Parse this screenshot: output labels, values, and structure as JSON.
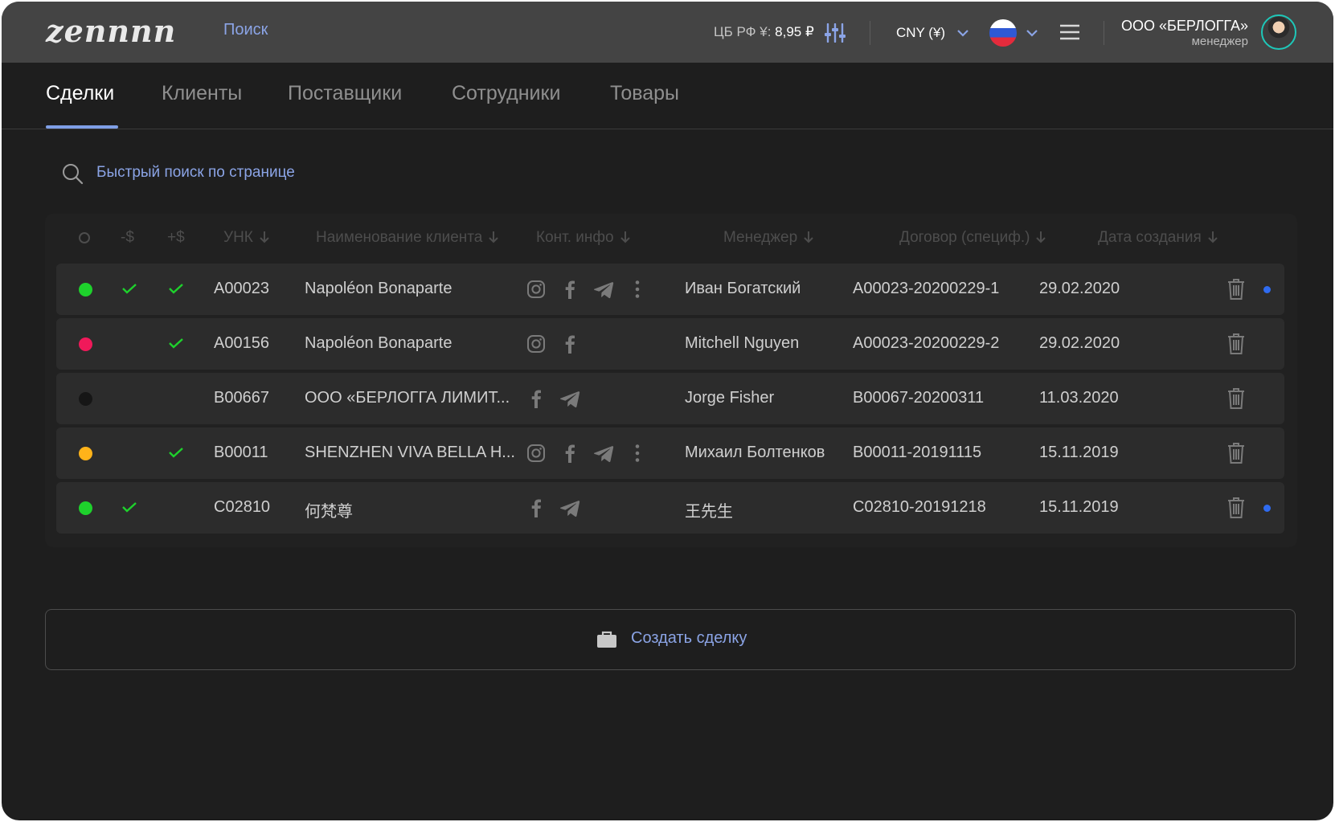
{
  "header": {
    "logo": "zennnn",
    "search_link": "Поиск",
    "rate_label": "ЦБ РФ ¥:",
    "rate_value": "8,95 ₽",
    "currency": "CNY (¥)",
    "language_flag": "russia-flag",
    "company_name": "ООО «БЕРЛОГГА»",
    "company_role": "менеджер"
  },
  "tabs": [
    {
      "label": "Сделки",
      "active": true
    },
    {
      "label": "Клиенты",
      "active": false
    },
    {
      "label": "Поставщики",
      "active": false
    },
    {
      "label": "Сотрудники",
      "active": false
    },
    {
      "label": "Товары",
      "active": false
    }
  ],
  "quick_search": {
    "placeholder": "Быстрый поиск по странице"
  },
  "table": {
    "columns": {
      "minus": "-$",
      "plus": "+$",
      "unk": "УНК",
      "client": "Наименование клиента",
      "contacts": "Конт. инфо",
      "manager": "Менеджер",
      "contract": "Договор (специф.)",
      "date": "Дата создания"
    },
    "rows": [
      {
        "status_color": "#1ed12c",
        "minus_check": true,
        "plus_check": true,
        "unk": "A00023",
        "client": "Napoléon Bonaparte",
        "contacts": [
          "instagram",
          "facebook",
          "telegram",
          "more"
        ],
        "manager": "Иван Богатский",
        "contract": "A00023-20200229-1",
        "date": "29.02.2020",
        "unread": true
      },
      {
        "status_color": "#f0195a",
        "minus_check": false,
        "plus_check": true,
        "unk": "A00156",
        "client": "Napoléon Bonaparte",
        "contacts": [
          "instagram",
          "facebook"
        ],
        "manager": "Mitchell Nguyen",
        "contract": "A00023-20200229-2",
        "date": "29.02.2020",
        "unread": false
      },
      {
        "status_color": "#161616",
        "minus_check": false,
        "plus_check": false,
        "unk": "B00667",
        "client": "ООО «БЕРЛОГГА ЛИМИТ...",
        "contacts": [
          "facebook",
          "telegram"
        ],
        "manager": "Jorge Fisher",
        "contract": "B00067-20200311",
        "date": "11.03.2020",
        "unread": false
      },
      {
        "status_color": "#ffb319",
        "minus_check": false,
        "plus_check": true,
        "unk": "B00011",
        "client": "SHENZHEN VIVA BELLA H...",
        "contacts": [
          "instagram",
          "facebook",
          "telegram",
          "more"
        ],
        "manager": "Михаил Болтенков",
        "contract": "B00011-20191115",
        "date": "15.11.2019",
        "unread": false
      },
      {
        "status_color": "#1ed12c",
        "minus_check": true,
        "plus_check": false,
        "unk": "C02810",
        "client": "何梵尊",
        "contacts": [
          "facebook",
          "telegram"
        ],
        "manager": "王先生",
        "contract": "C02810-20191218",
        "date": "15.11.2019",
        "unread": true
      }
    ]
  },
  "create_deal": {
    "label": "Создать сделку"
  },
  "colors": {
    "accent": "#8ba4e6",
    "check": "#1ed12c",
    "background": "#1e1e1e",
    "topbar": "#444444"
  }
}
